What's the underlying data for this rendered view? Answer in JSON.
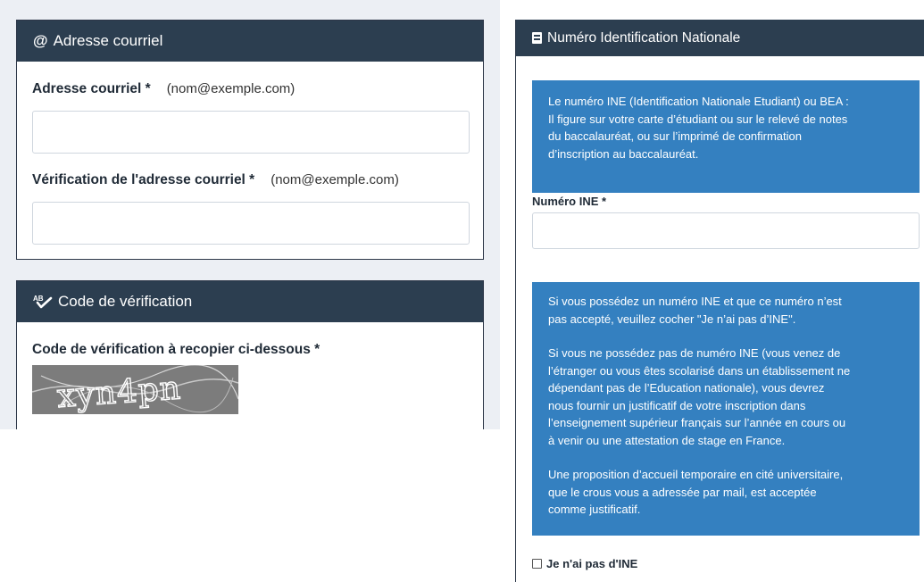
{
  "email_card": {
    "icon": "at-icon",
    "title": "Adresse courriel",
    "email_label": "Adresse courriel *",
    "email_hint": "(nom@exemple.com)",
    "email_value": "",
    "confirm_label": "Vérification de l'adresse courriel *",
    "confirm_hint": "(nom@exemple.com)",
    "confirm_value": ""
  },
  "captcha_card": {
    "icon": "ab-check-icon",
    "title": "Code de vérification",
    "label": "Code de vérification à recopier ci-dessous *",
    "captcha_text": "xyn4pn"
  },
  "ine_card": {
    "icon": "id-card-icon",
    "title": "Numéro Identification Nationale",
    "info_lines": [
      "Le numéro INE (Identification Nationale Etudiant) ou BEA :",
      "Il figure sur votre carte d’étudiant ou sur le relevé de notes",
      "du baccalauréat, ou sur l’imprimé de confirmation",
      "d’inscription au baccalauréat."
    ],
    "ine_label": "Numéro INE *",
    "ine_value": "",
    "help_p1": [
      "Si vous possédez un numéro INE et que ce numéro n’est",
      "pas accepté, veuillez cocher \"Je n’ai pas d’INE\"."
    ],
    "help_p2": [
      "Si vous ne possédez pas de numéro INE (vous venez de",
      "l’étranger ou vous êtes scolarisé dans un établissement ne",
      "dépendant pas de l’Education nationale), vous devrez",
      "nous fournir un justificatif de votre inscription dans",
      "l’enseignement supérieur français sur l’année en cours ou",
      "à venir ou une attestation de stage en France."
    ],
    "help_p3": [
      "Une proposition d’accueil temporaire en cité universitaire,",
      "que le crous vous a adressée par mail, est acceptée",
      "comme justificatif."
    ],
    "no_ine_label": "Je n'ai pas d'INE",
    "no_ine_checked": false
  },
  "colors": {
    "header_bg": "#2c3e50",
    "info_bg": "#3480c0",
    "pane_bg": "#eceff4"
  }
}
